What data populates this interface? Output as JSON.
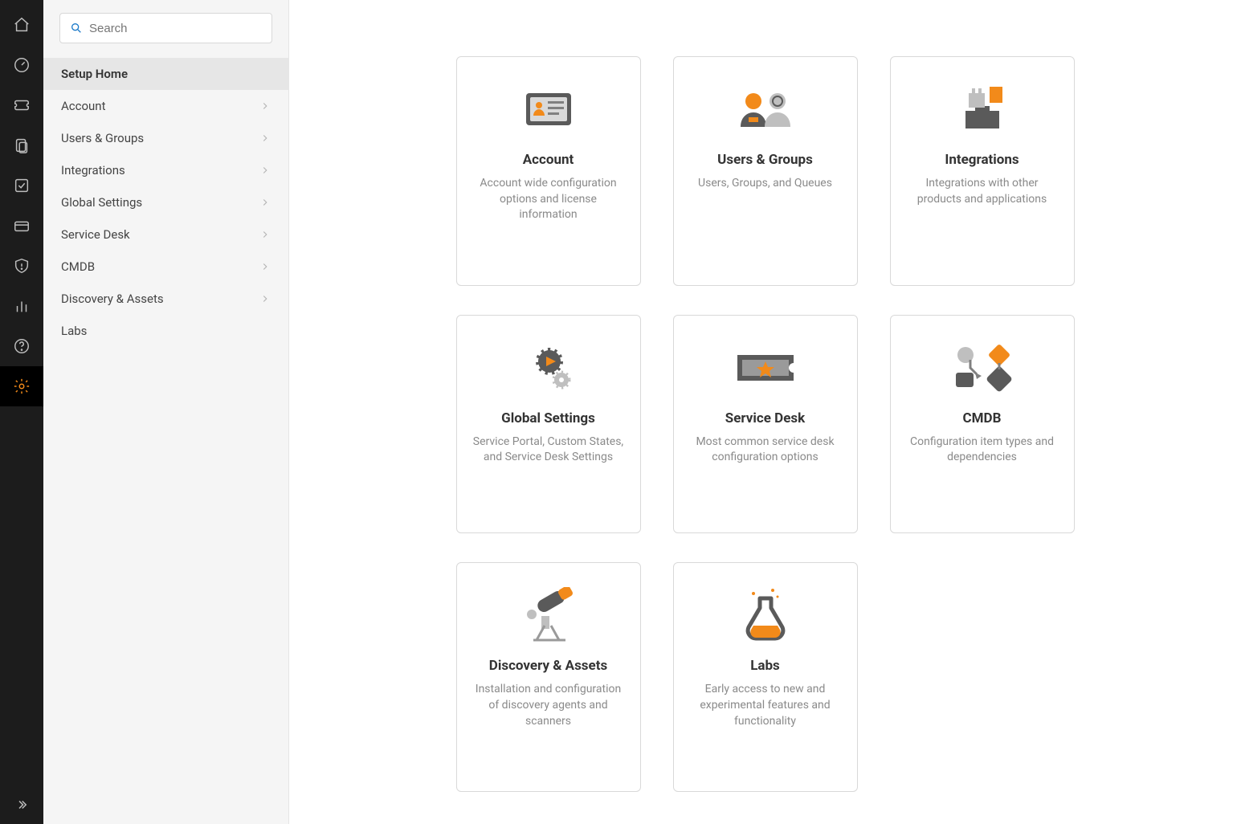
{
  "search": {
    "placeholder": "Search"
  },
  "rail": {
    "items": [
      {
        "name": "home-icon"
      },
      {
        "name": "gauge-icon"
      },
      {
        "name": "ticket-icon"
      },
      {
        "name": "clipboard-icon"
      },
      {
        "name": "approvals-icon"
      },
      {
        "name": "card-icon"
      },
      {
        "name": "shield-icon"
      },
      {
        "name": "analytics-icon"
      },
      {
        "name": "help-icon"
      },
      {
        "name": "settings-icon",
        "active": true
      }
    ],
    "expand_name": "expand-icon"
  },
  "sidebar": {
    "items": [
      {
        "label": "Setup Home",
        "active": true,
        "hasChildren": false
      },
      {
        "label": "Account",
        "active": false,
        "hasChildren": true
      },
      {
        "label": "Users & Groups",
        "active": false,
        "hasChildren": true
      },
      {
        "label": "Integrations",
        "active": false,
        "hasChildren": true
      },
      {
        "label": "Global Settings",
        "active": false,
        "hasChildren": true
      },
      {
        "label": "Service Desk",
        "active": false,
        "hasChildren": true
      },
      {
        "label": "CMDB",
        "active": false,
        "hasChildren": true
      },
      {
        "label": "Discovery & Assets",
        "active": false,
        "hasChildren": true
      },
      {
        "label": "Labs",
        "active": false,
        "hasChildren": false
      }
    ]
  },
  "cards": [
    {
      "icon": "account-card-icon",
      "title": "Account",
      "desc": "Account wide configuration options and license information"
    },
    {
      "icon": "users-card-icon",
      "title": "Users & Groups",
      "desc": "Users, Groups, and Queues"
    },
    {
      "icon": "integrations-card-icon",
      "title": "Integrations",
      "desc": "Integrations with other products and applications"
    },
    {
      "icon": "globalsettings-card-icon",
      "title": "Global Settings",
      "desc": "Service Portal, Custom States, and Service Desk Settings"
    },
    {
      "icon": "servicedesk-card-icon",
      "title": "Service Desk",
      "desc": "Most common service desk configuration options"
    },
    {
      "icon": "cmdb-card-icon",
      "title": "CMDB",
      "desc": "Configuration item types and dependencies"
    },
    {
      "icon": "discovery-card-icon",
      "title": "Discovery & Assets",
      "desc": "Installation and configuration of discovery agents and scanners"
    },
    {
      "icon": "labs-card-icon",
      "title": "Labs",
      "desc": "Early access to new and experimental features and functionality"
    }
  ],
  "colors": {
    "accent": "#f28a1a",
    "iconGrey": "#808080",
    "iconDark": "#5a5a5a"
  }
}
